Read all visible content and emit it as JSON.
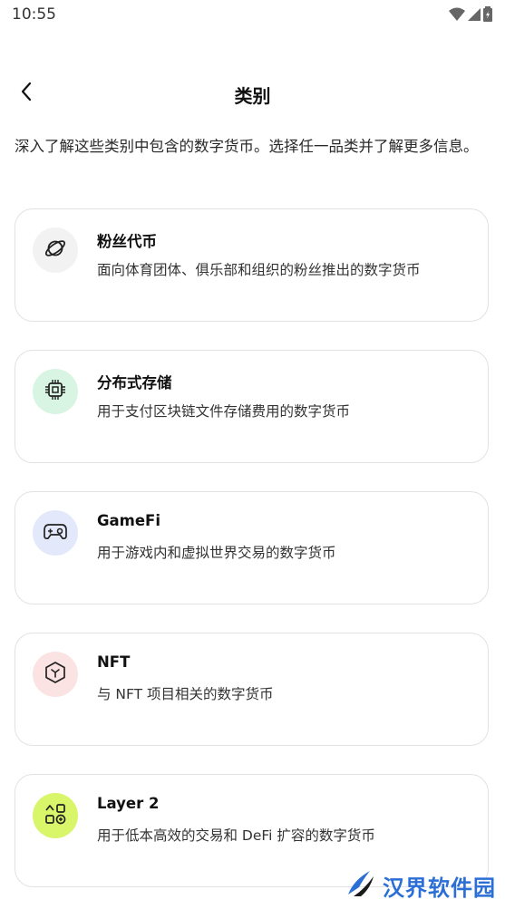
{
  "status_bar": {
    "time": "10:55"
  },
  "header": {
    "title": "类别"
  },
  "intro": {
    "text": "深入了解这些类别中包含的数字货币。选择任一品类并了解更多信息。"
  },
  "categories": [
    {
      "title": "粉丝代币",
      "description": "面向体育团体、俱乐部和组织的粉丝推出的数字货币",
      "icon": "planet-icon",
      "icon_bg": "#f2f2f2",
      "icon_color": "#222222"
    },
    {
      "title": "分布式存储",
      "description": "用于支付区块链文件存储费用的数字货币",
      "icon": "chip-icon",
      "icon_bg": "#d8f5e3",
      "icon_color": "#222222"
    },
    {
      "title": "GameFi",
      "description": "用于游戏内和虚拟世界交易的数字货币",
      "icon": "gamepad-icon",
      "icon_bg": "#e3e8fb",
      "icon_color": "#222222"
    },
    {
      "title": "NFT",
      "description": "与 NFT 项目相关的数字货币",
      "icon": "cube-icon",
      "icon_bg": "#fbe3e3",
      "icon_color": "#222222"
    },
    {
      "title": "Layer 2",
      "description": "用于低本高效的交易和 DeFi 扩容的数字货币",
      "icon": "shapes-icon",
      "icon_bg": "#d9f56a",
      "icon_color": "#222222"
    }
  ],
  "watermark": {
    "text": "汉界软件园"
  }
}
